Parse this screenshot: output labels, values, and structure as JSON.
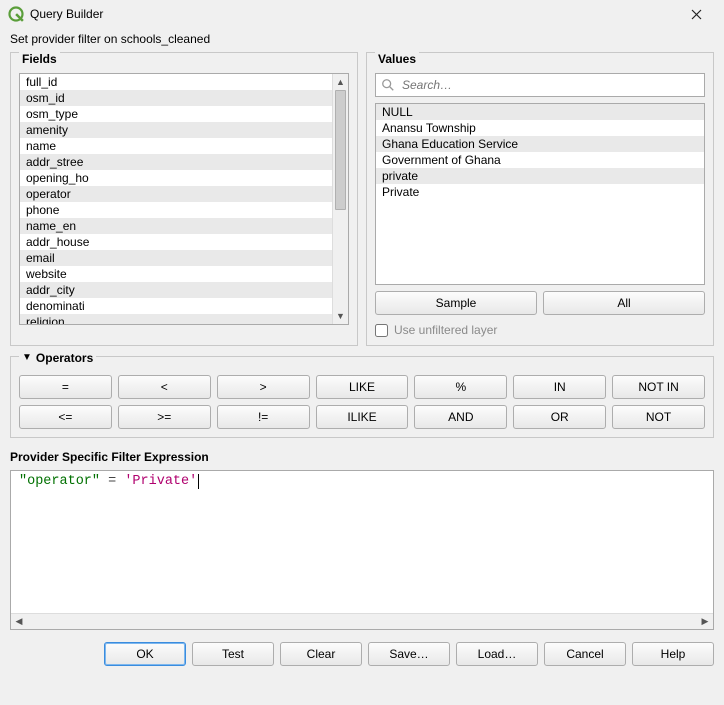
{
  "window": {
    "title": "Query Builder",
    "subtitle": "Set provider filter on schools_cleaned"
  },
  "panels": {
    "fields": "Fields",
    "values": "Values",
    "operators": "Operators",
    "expression": "Provider Specific Filter Expression"
  },
  "fields": [
    "full_id",
    "osm_id",
    "osm_type",
    "amenity",
    "name",
    "addr_stree",
    "opening_ho",
    "operator",
    "phone",
    "name_en",
    "addr_house",
    "email",
    "website",
    "addr_city",
    "denominati",
    "religion"
  ],
  "search": {
    "placeholder": "Search…"
  },
  "values_list": [
    "NULL",
    "Anansu Township",
    "Ghana Education Service",
    "Government of Ghana",
    "private",
    "Private"
  ],
  "values_buttons": {
    "sample": "Sample",
    "all": "All"
  },
  "checkbox": {
    "unfiltered": "Use unfiltered layer",
    "checked": false
  },
  "operators_row1": [
    "=",
    "<",
    ">",
    "LIKE",
    "%",
    "IN",
    "NOT IN"
  ],
  "operators_row2": [
    "<=",
    ">=",
    "!=",
    "ILIKE",
    "AND",
    "OR",
    "NOT"
  ],
  "expression": {
    "field": "\"operator\"",
    "op": " = ",
    "value": "'Private'"
  },
  "buttons": {
    "ok": "OK",
    "test": "Test",
    "clear": "Clear",
    "save": "Save…",
    "load": "Load…",
    "cancel": "Cancel",
    "help": "Help"
  }
}
